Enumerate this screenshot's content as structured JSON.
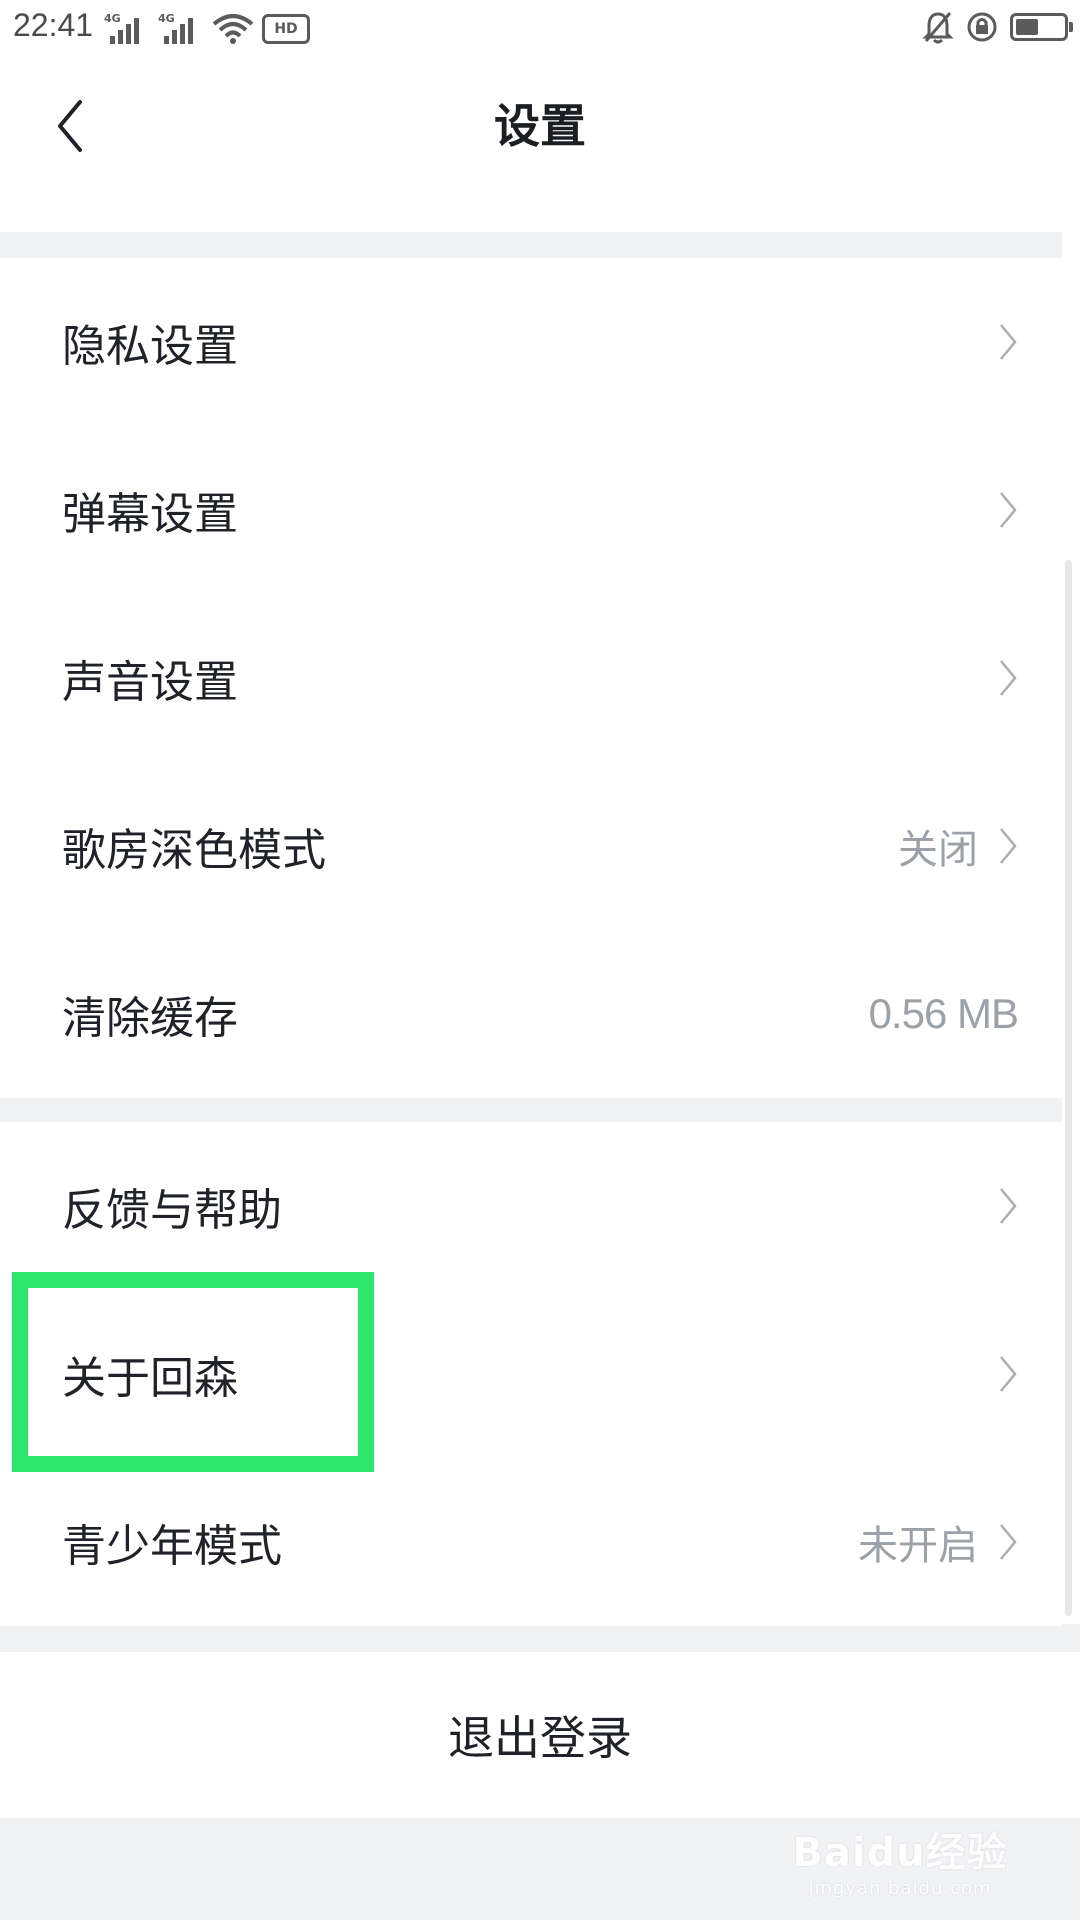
{
  "status_bar": {
    "time": "22:41",
    "signal_1": "4G",
    "signal_2": "4G",
    "hd": "HD"
  },
  "header": {
    "title": "设置",
    "back_icon": "chevron-left-icon"
  },
  "group_1": {
    "items": [
      {
        "label": "隐私设置",
        "value": ""
      },
      {
        "label": "弹幕设置",
        "value": ""
      },
      {
        "label": "声音设置",
        "value": ""
      },
      {
        "label": "歌房深色模式",
        "value": "关闭"
      },
      {
        "label": "清除缓存",
        "value": "0.56 MB"
      }
    ]
  },
  "group_2": {
    "items": [
      {
        "label": "反馈与帮助",
        "value": ""
      },
      {
        "label": "关于回森",
        "value": ""
      },
      {
        "label": "青少年模式",
        "value": "未开启"
      }
    ]
  },
  "footer": {
    "logout_label": "退出登录"
  },
  "watermark": {
    "main": "Baidu经验",
    "sub": "jingyan.baidu.com"
  },
  "colors": {
    "highlight": "#2ee66b",
    "background": "#f1f2f4",
    "value_text": "#9ba1a9"
  }
}
